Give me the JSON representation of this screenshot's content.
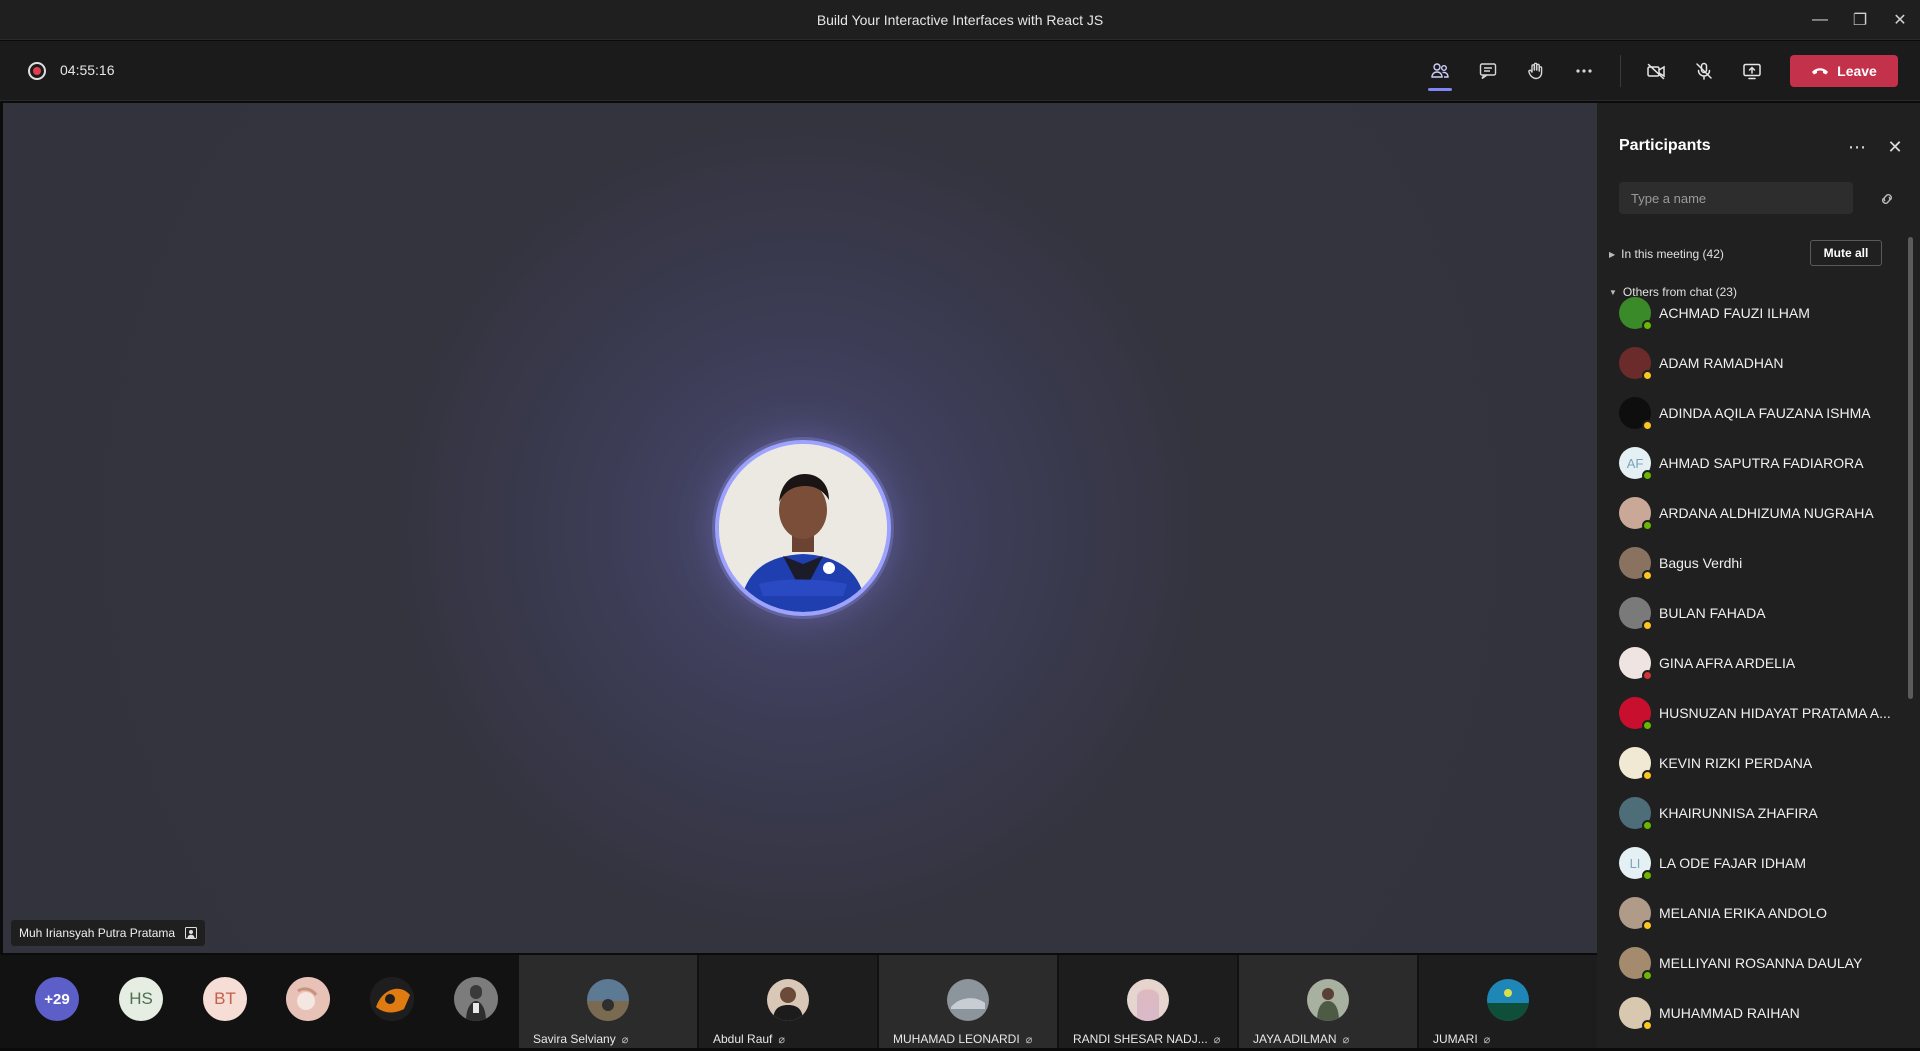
{
  "window": {
    "title": "Build Your Interactive Interfaces with React JS",
    "minimize_glyph": "—",
    "restore_glyph": "❐",
    "close_glyph": "✕"
  },
  "toolbar": {
    "timer": "04:55:16",
    "leave_label": "Leave",
    "icons": [
      "people-icon",
      "chat-icon",
      "raise-hand-icon",
      "more-icon",
      "camera-off-icon",
      "mic-off-icon",
      "share-screen-icon"
    ]
  },
  "stage": {
    "speaker_name": "Muh Iriansyah Putra Pratama"
  },
  "strip": {
    "overflow_count": "+29",
    "mini": [
      {
        "initials": "HS",
        "bg": "#e6ede2",
        "fg": "#4f6f52"
      },
      {
        "initials": "BT",
        "bg": "#f6ddd5",
        "fg": "#c45f4a"
      }
    ],
    "tiles": [
      {
        "name": "Savira Selviany"
      },
      {
        "name": "Abdul Rauf"
      },
      {
        "name": "MUHAMAD LEONARDI"
      },
      {
        "name": "RANDI SHESAR NADJ..."
      },
      {
        "name": "JAYA ADILMAN"
      },
      {
        "name": "JUMARI"
      }
    ]
  },
  "panel": {
    "title": "Participants",
    "search_placeholder": "Type a name",
    "in_meeting": "In this meeting (42)",
    "mute_all": "Mute all",
    "others": "Others from chat (23)",
    "participants": [
      {
        "name": "ACHMAD FAUZI ILHAM",
        "initials": "",
        "status": "#6bb700",
        "bg": "#3b8a2a"
      },
      {
        "name": "ADAM RAMADHAN",
        "initials": "",
        "status": "#fcc51f",
        "bg": "#6b2b2b"
      },
      {
        "name": "ADINDA AQILA FAUZANA ISHMA",
        "initials": "",
        "status": "#fcc51f",
        "bg": "#0e0e0e"
      },
      {
        "name": "AHMAD SAPUTRA FADIARORA",
        "initials": "AF",
        "status": "#6bb700",
        "bg": "#e5f0f5"
      },
      {
        "name": "ARDANA ALDHIZUMA NUGRAHA",
        "initials": "",
        "status": "#6bb700",
        "bg": "#c9a897"
      },
      {
        "name": "Bagus Verdhi",
        "initials": "",
        "status": "#fcc51f",
        "bg": "#8a7260"
      },
      {
        "name": "BULAN FAHADA",
        "initials": "",
        "status": "#fcc51f",
        "bg": "#7a7a7a"
      },
      {
        "name": "GINA AFRA ARDELIA",
        "initials": "",
        "status": "#d13438",
        "bg": "#f0e4e2"
      },
      {
        "name": "HUSNUZAN HIDAYAT PRATAMA A...",
        "initials": "",
        "status": "#6bb700",
        "bg": "#c8102e"
      },
      {
        "name": "KEVIN RIZKI PERDANA",
        "initials": "",
        "status": "#fcc51f",
        "bg": "#f1e9d3"
      },
      {
        "name": "KHAIRUNNISA ZHAFIRA",
        "initials": "",
        "status": "#6bb700",
        "bg": "#4d6d78"
      },
      {
        "name": "LA ODE FAJAR IDHAM",
        "initials": "LI",
        "status": "#6bb700",
        "bg": "#e5f0f5"
      },
      {
        "name": "MELANIA ERIKA ANDOLO",
        "initials": "",
        "status": "#fcc51f",
        "bg": "#b09a88"
      },
      {
        "name": "MELLIYANI ROSANNA DAULAY",
        "initials": "",
        "status": "#6bb700",
        "bg": "#a58b6e"
      },
      {
        "name": "MUHAMMAD RAIHAN",
        "initials": "",
        "status": "#fcc51f",
        "bg": "#d8c8b0"
      }
    ]
  }
}
